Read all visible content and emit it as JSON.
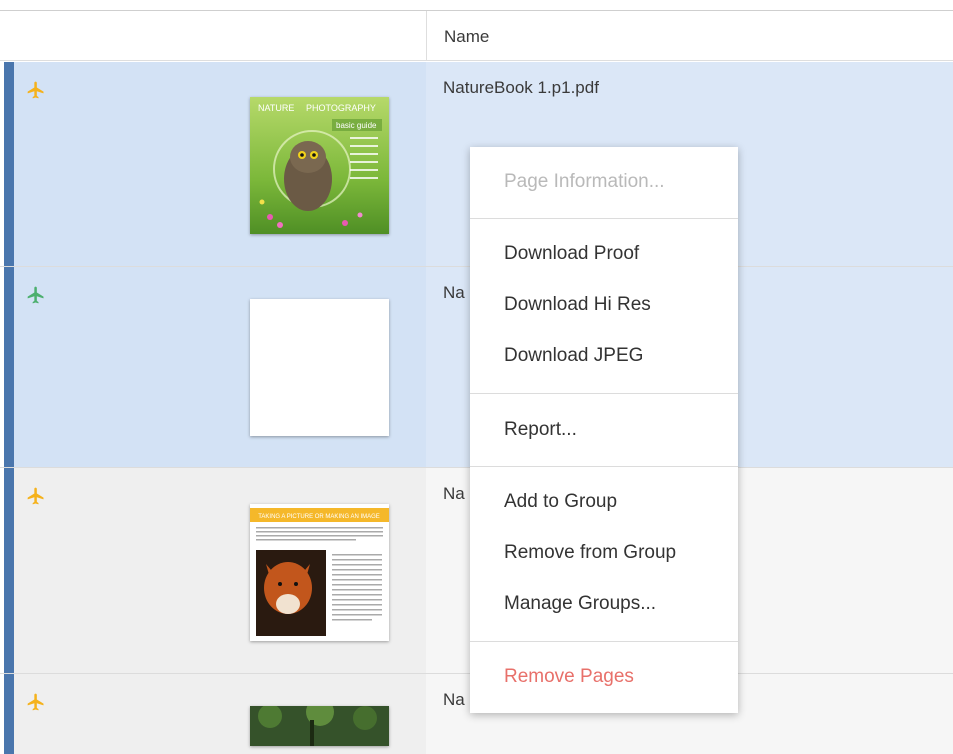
{
  "table": {
    "columns": {
      "name": "Name"
    }
  },
  "rows": [
    {
      "name": "NatureBook 1.p1.pdf",
      "status_icon": "airplane-icon",
      "status_color": "#f5b21c",
      "selected": true
    },
    {
      "name": "Na",
      "status_icon": "airplane-icon",
      "status_color": "#4caf6e",
      "selected": true
    },
    {
      "name": "Na",
      "status_icon": "airplane-icon",
      "status_color": "#f5b21c",
      "selected": false
    },
    {
      "name": "Na",
      "status_icon": "airplane-icon",
      "status_color": "#f5b21c",
      "selected": false
    }
  ],
  "thumbnails": {
    "page1": {
      "title_a": "NATURE",
      "title_b": "PHOTOGRAPHY",
      "subtitle": "basic guide"
    },
    "page3": {
      "header": "TAKING A PICTURE OR MAKING AN IMAGE"
    }
  },
  "context_menu": {
    "page_information": "Page Information...",
    "download_proof": "Download Proof",
    "download_hi_res": "Download Hi Res",
    "download_jpeg": "Download JPEG",
    "report": "Report...",
    "add_to_group": "Add to Group",
    "remove_from_group": "Remove from Group",
    "manage_groups": "Manage Groups...",
    "remove_pages": "Remove Pages"
  },
  "colors": {
    "selection_accent": "#4a76ad",
    "danger": "#e8706a",
    "disabled": "#b9b9b9"
  }
}
